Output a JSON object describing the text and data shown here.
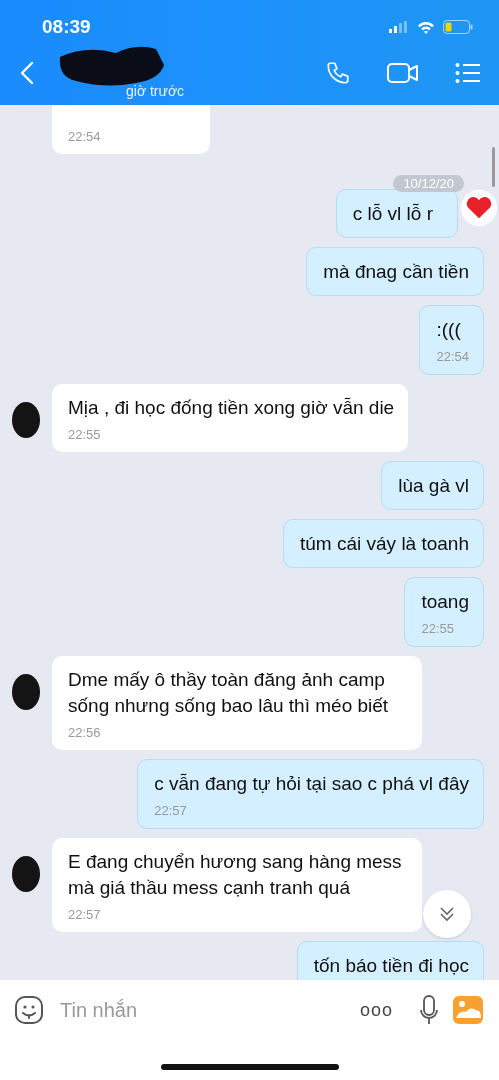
{
  "status_bar": {
    "time": "08:39"
  },
  "header": {
    "subtitle": "giờ trước"
  },
  "messages": [
    {
      "kind": "received",
      "time": "22:54",
      "avatar": false
    },
    {
      "kind": "sent",
      "text": "c lỗ vl lỗ r",
      "date": "10/12/20",
      "reacted": true
    },
    {
      "kind": "sent",
      "text": "mà đnag cần tiền"
    },
    {
      "kind": "sent",
      "text": ":(((",
      "time": "22:54"
    },
    {
      "kind": "received",
      "text": "Mịa , đi học đống tiền xong giờ vẫn die",
      "time": "22:55",
      "avatar": true
    },
    {
      "kind": "sent",
      "text": "lùa gà vl"
    },
    {
      "kind": "sent",
      "text": "túm cái váy là toanh"
    },
    {
      "kind": "sent",
      "text": "toang",
      "time": "22:55"
    },
    {
      "kind": "received",
      "text": "Dme mấy ô thầy toàn đăng ảnh camp sống nhưng sống bao lâu thì méo biết",
      "time": "22:56",
      "avatar": true
    },
    {
      "kind": "sent",
      "text": "c vẫn đang tự hỏi tại sao c phá vl đây",
      "time": "22:57"
    },
    {
      "kind": "received",
      "text": "E đang chuyển hương sang hàng mess mà giá thầu mess cạnh tranh quá",
      "time": "22:57",
      "avatar": true
    },
    {
      "kind": "sent",
      "text": "tốn báo tiền đi học"
    }
  ],
  "composer": {
    "placeholder": "Tin nhắn",
    "more": "ooo"
  }
}
